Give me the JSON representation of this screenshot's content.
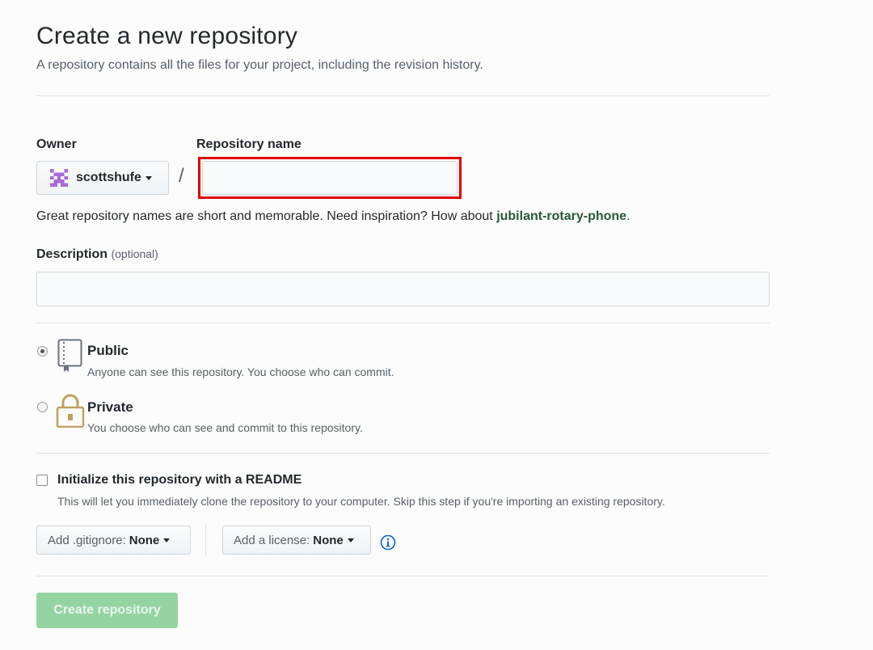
{
  "header": {
    "title": "Create a new repository",
    "subtitle": "A repository contains all the files for your project, including the revision history."
  },
  "owner": {
    "label": "Owner",
    "value": "scottshufe",
    "avatar_icon": "identicon-avatar"
  },
  "separator": "/",
  "repo_name": {
    "label": "Repository name",
    "value": "",
    "highlight_color": "#e00000"
  },
  "hint": {
    "text": "Great repository names are short and memorable. Need inspiration? How about ",
    "suggestion": "jubilant-rotary-phone",
    "end": "."
  },
  "description": {
    "label": "Description",
    "optional": "(optional)",
    "value": ""
  },
  "visibility": {
    "selected": "public",
    "public": {
      "title": "Public",
      "desc": "Anyone can see this repository. You choose who can commit.",
      "icon": "repo-book-icon"
    },
    "private": {
      "title": "Private",
      "desc": "You choose who can see and commit to this repository.",
      "icon": "lock-icon"
    }
  },
  "readme": {
    "checked": false,
    "title": "Initialize this repository with a README",
    "desc": "This will let you immediately clone the repository to your computer. Skip this step if you're importing an existing repository."
  },
  "gitignore": {
    "label": "Add .gitignore:",
    "value": "None"
  },
  "license": {
    "label": "Add a license:",
    "value": "None"
  },
  "info_icon": "info-icon",
  "create_button": {
    "label": "Create repository",
    "color": "#94d3a2"
  }
}
